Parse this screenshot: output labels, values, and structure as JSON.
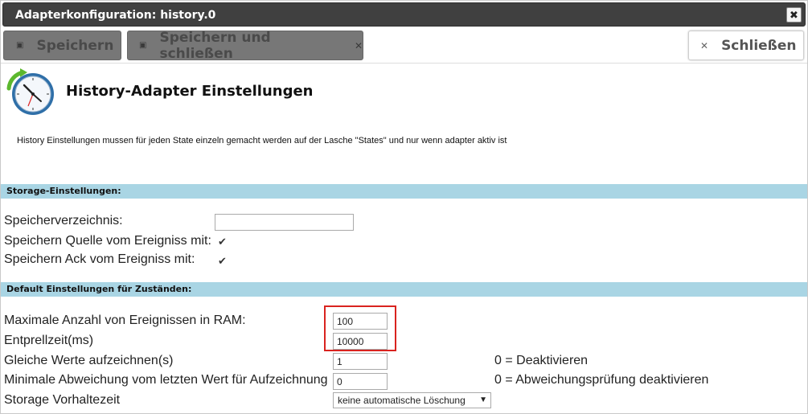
{
  "window": {
    "title": "Adapterkonfiguration: history.0",
    "close_glyph": "✖"
  },
  "toolbar": {
    "save_label": "Speichern",
    "save_close_label": "Speichern und schließen",
    "close_label": "Schließen"
  },
  "header": {
    "title": "History-Adapter Einstellungen",
    "info": "History Einstellungen mussen für jeden State einzeln gemacht werden auf der Lasche \"States\" und nur wenn adapter aktiv ist"
  },
  "storage": {
    "section_title": "Storage-Einstellungen:",
    "dir_label": "Speicherverzeichnis:",
    "dir_value": "",
    "source_label": "Speichern Quelle vom Ereigniss mit:",
    "source_checked": true,
    "ack_label": "Speichern Ack vom Ereigniss mit:",
    "ack_checked": true
  },
  "defaults": {
    "section_title": "Default Einstellungen für Zuständen:",
    "max_events_label": "Maximale Anzahl von Ereignissen in RAM:",
    "max_events_value": "100",
    "debounce_label": "Entprellzeit(ms)",
    "debounce_value": "10000",
    "same_values_label": "Gleiche Werte aufzeichnen(s)",
    "same_values_value": "1",
    "same_values_note": "0 = Deaktivieren",
    "min_change_label": "Minimale Abweichung vom letzten Wert für Aufzeichnung",
    "min_change_value": "0",
    "min_change_note": "0 = Abweichungsprüfung deaktivieren",
    "retention_label": "Storage Vorhaltezeit",
    "retention_value": "keine automatische Löschung"
  },
  "colors": {
    "titlebar": "#404040",
    "section": "#a9d5e4",
    "highlight": "#d9231f"
  }
}
